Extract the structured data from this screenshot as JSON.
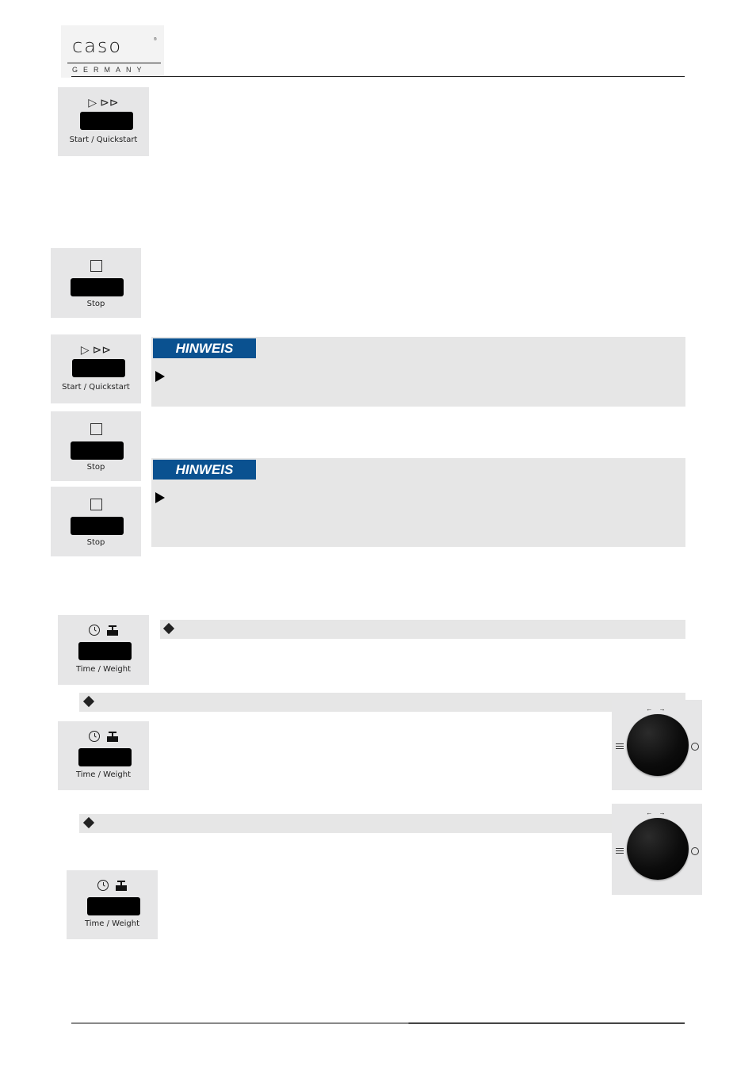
{
  "header": {
    "brand": "caso",
    "brand_mark": "®",
    "brand_sub": "GERMANY"
  },
  "buttons": {
    "start_quickstart": {
      "label": "Start / Quickstart",
      "icon": "play-fastforward-icon",
      "symbol_single": "▷",
      "symbol_double": "⊳⊳"
    },
    "stop": {
      "label": "Stop",
      "icon": "stop-square-icon"
    },
    "time_weight": {
      "label": "Time / Weight",
      "icon": "clock-weight-icon"
    }
  },
  "notices": [
    {
      "tag": "HINWEIS"
    },
    {
      "tag": "HINWEIS"
    }
  ],
  "knob": {
    "arrows": "←  →",
    "left_icon": "list-icon",
    "right_icon": "clock-icon"
  },
  "colors": {
    "notice_blue": "#0a5190",
    "panel_grey": "#e6e6e7"
  }
}
